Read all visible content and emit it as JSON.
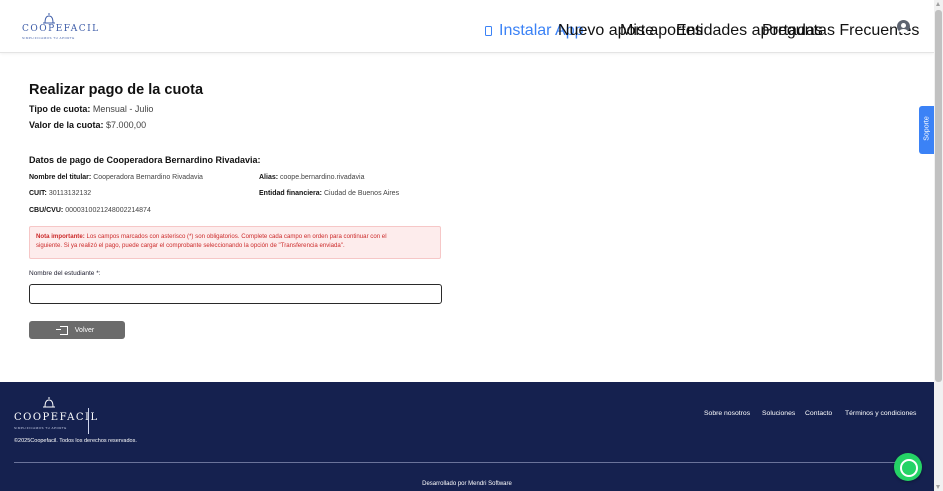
{
  "header": {
    "logo_word": "COOPEFACIL",
    "logo_tagline": "SIMPLIFICAMOS TU APORTE",
    "nav": {
      "install": "Instalar App",
      "new_contribution": "Nuevo aporte",
      "my_contributions": "Mis aportes",
      "entities": "Entidades aportadas",
      "faq": "Preguntas Frecuentes"
    },
    "icons": {
      "install": "smartphone-icon",
      "user": "user-circle-icon"
    }
  },
  "support_tab": "Soporte",
  "main": {
    "title": "Realizar pago de la cuota",
    "fee_type_label": "Tipo de cuota:",
    "fee_type_value": "Mensual - Julio",
    "fee_value_label": "Valor de la cuota:",
    "fee_value": "$7.000,00",
    "payment_section_title": "Datos de pago de Cooperadora Bernardino Rivadavia:",
    "holder_label": "Nombre del titular:",
    "holder_value": "Cooperadora Bernardino Rivadavia",
    "alias_label": "Alias:",
    "alias_value": "coope.bernardino.rivadavia",
    "cuit_label": "CUIT:",
    "cuit_value": "30113132132",
    "bank_label": "Entidad financiera:",
    "bank_value": "Ciudad de Buenos Aires",
    "cbu_label": "CBU/CVU:",
    "cbu_value": "0000310021248002214874",
    "alert_strong": "Nota importante:",
    "alert_line1": " Los campos marcados con asterisco (*) son obligatorios. Complete cada campo en orden para continuar con el",
    "alert_line2": "siguiente. Si ya realizó el pago, puede cargar el comprobante seleccionando la opción de \"Transferencia enviada\".",
    "student_label": "Nombre del estudiante *:",
    "student_value": "",
    "back_button": "Volver"
  },
  "footer": {
    "logo_word": "COOPEFACIL",
    "logo_tagline": "SIMPLIFICAMOS TU APORTE",
    "copyright": "©2025Coopefacil. Todos los derechos reservados.",
    "links": [
      "Sobre nosotros",
      "Soluciones",
      "Contacto",
      "Términos y condiciones"
    ],
    "credit": "Desarrollado por Mendri Software"
  },
  "colors": {
    "accent": "#3b82f6",
    "footer_bg": "#15214f",
    "alert_bg": "#fdecec",
    "alert_text": "#cc2b2b",
    "whatsapp": "#25d366",
    "button_gray": "#6b6b6b"
  }
}
